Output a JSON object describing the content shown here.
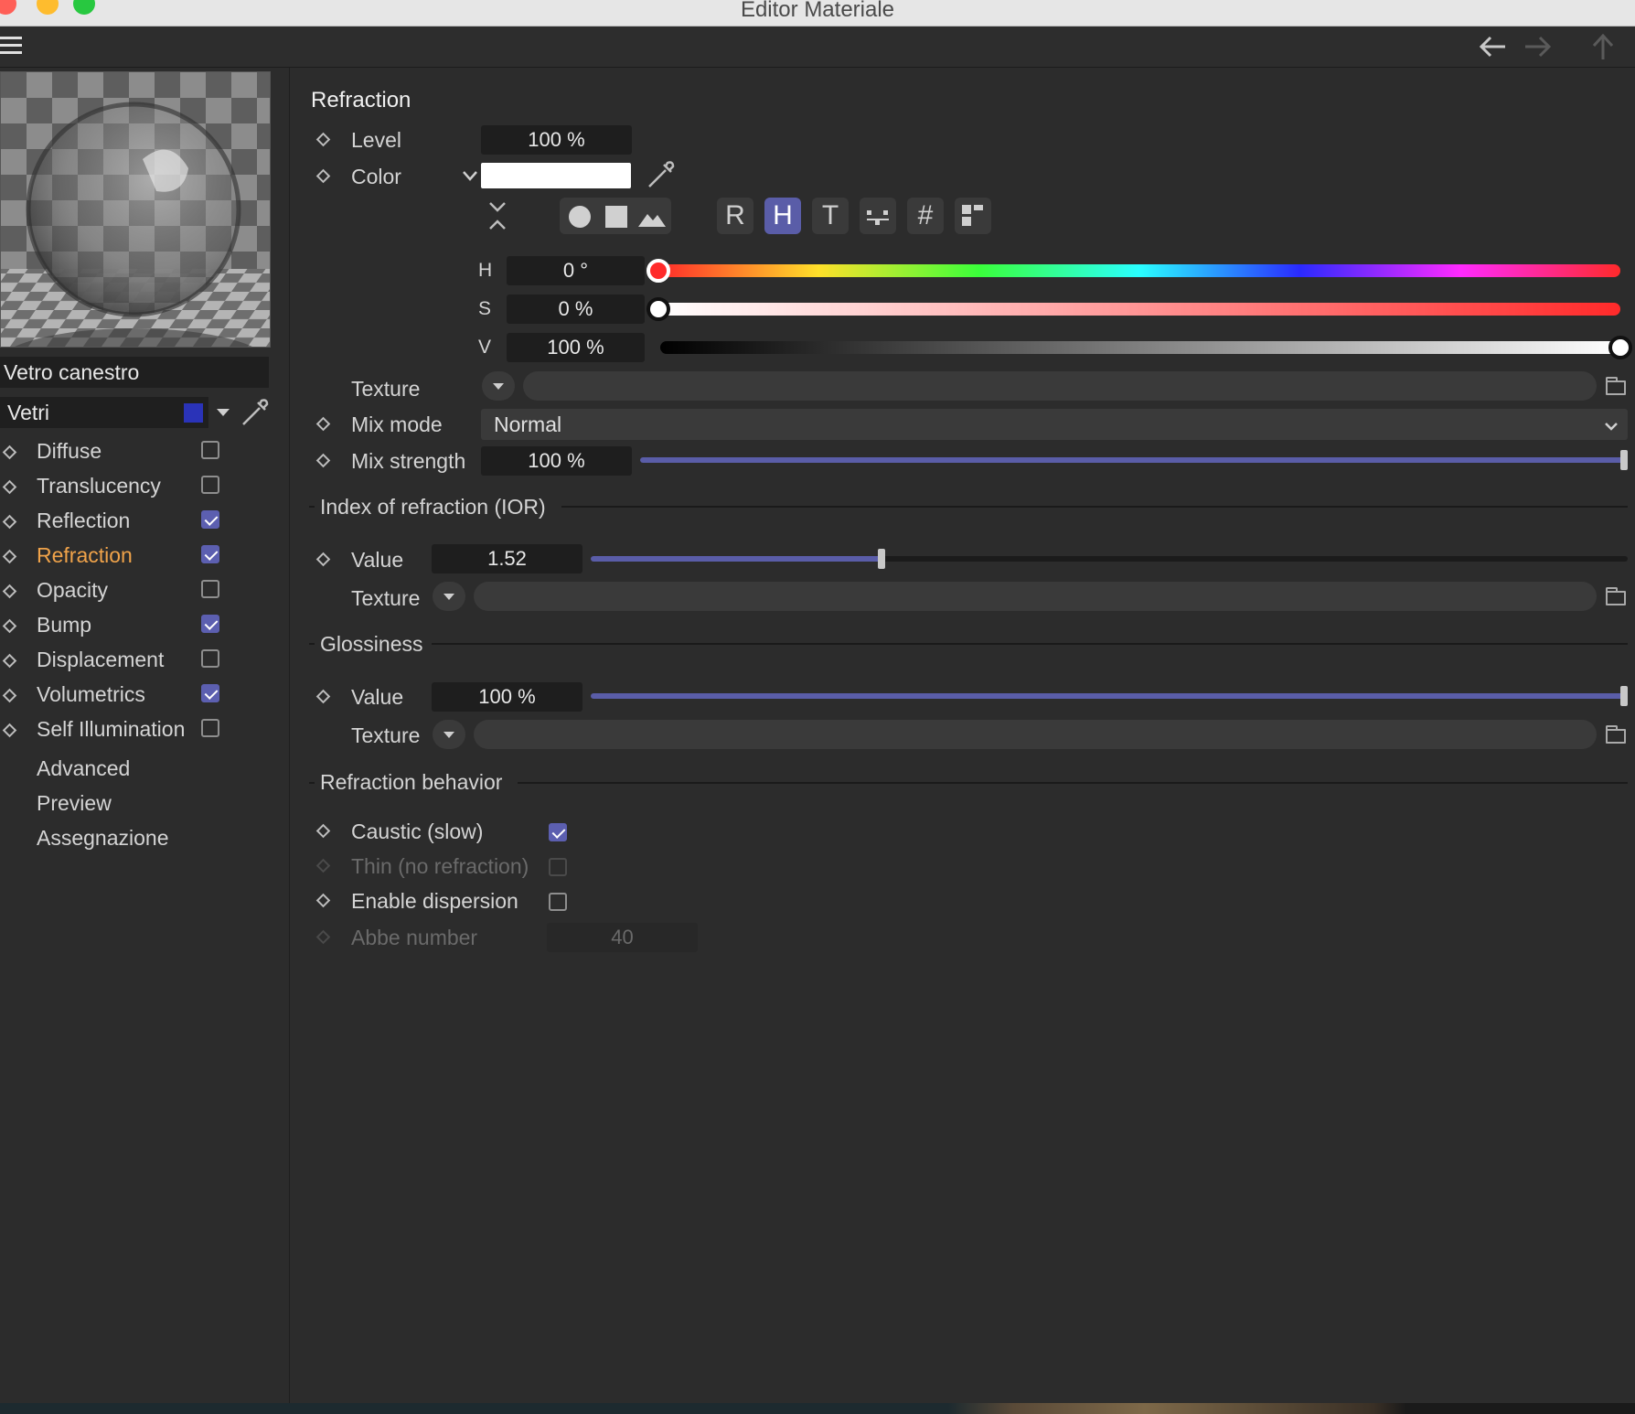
{
  "window": {
    "title": "Editor Materiale"
  },
  "material": {
    "name": "Vetro canestro",
    "layer": "Vetri",
    "layer_color": "#2a33b8"
  },
  "channels": [
    {
      "label": "Diffuse",
      "checked": false
    },
    {
      "label": "Translucency",
      "checked": false
    },
    {
      "label": "Reflection",
      "checked": true
    },
    {
      "label": "Refraction",
      "checked": true,
      "active": true
    },
    {
      "label": "Opacity",
      "checked": false
    },
    {
      "label": "Bump",
      "checked": true
    },
    {
      "label": "Displacement",
      "checked": false
    },
    {
      "label": "Volumetrics",
      "checked": true
    },
    {
      "label": "Self Illumination",
      "checked": false
    }
  ],
  "extra_items": [
    "Advanced",
    "Preview",
    "Assegnazione"
  ],
  "refraction": {
    "title": "Refraction",
    "level_label": "Level",
    "level_value": "100 %",
    "color_label": "Color",
    "color_swatch": "#ffffff",
    "mode_buttons": [
      "R",
      "H",
      "T",
      "#"
    ],
    "selected_mode": "H",
    "h_label": "H",
    "h_value": "0 °",
    "h_fraction": 0,
    "s_label": "S",
    "s_value": "0 %",
    "s_fraction": 0,
    "v_label": "V",
    "v_value": "100 %",
    "v_fraction": 1,
    "texture_label": "Texture",
    "mix_mode_label": "Mix mode",
    "mix_mode_value": "Normal",
    "mix_strength_label": "Mix strength",
    "mix_strength_value": "100 %",
    "mix_strength_fraction": 1
  },
  "ior": {
    "title": "Index of refraction (IOR)",
    "value_label": "Value",
    "value": "1.52",
    "fraction": 0.28,
    "texture_label": "Texture"
  },
  "glossiness": {
    "title": "Glossiness",
    "value_label": "Value",
    "value": "100 %",
    "fraction": 1,
    "texture_label": "Texture"
  },
  "behavior": {
    "title": "Refraction behavior",
    "caustic_label": "Caustic (slow)",
    "caustic_checked": true,
    "thin_label": "Thin (no refraction)",
    "thin_checked": false,
    "dispersion_label": "Enable dispersion",
    "dispersion_checked": false,
    "abbe_label": "Abbe number",
    "abbe_value": "40"
  },
  "colors": {
    "accent": "#5a5da8",
    "active_channel": "#f0a34a",
    "close": "#ff5f57",
    "minimize": "#febc2e",
    "zoom": "#28c840"
  }
}
